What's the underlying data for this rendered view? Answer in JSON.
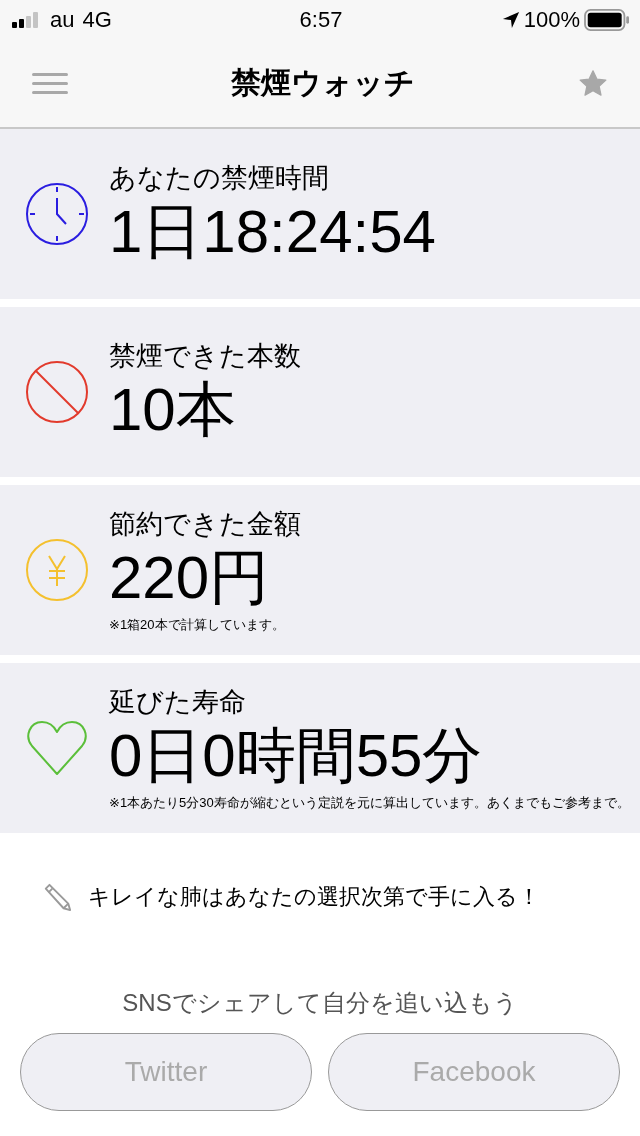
{
  "status_bar": {
    "carrier": "au",
    "network": "4G",
    "time": "6:57",
    "battery": "100%"
  },
  "nav_bar": {
    "title": "禁煙ウォッチ"
  },
  "stats": [
    {
      "kind": "clock",
      "label": "あなたの禁煙時間",
      "value": "1日18:24:54"
    },
    {
      "kind": "prohibited",
      "label": "禁煙できた本数",
      "value": "10本"
    },
    {
      "kind": "yen",
      "label": "節約できた金額",
      "value": "220円",
      "note": "※1箱20本で計算しています。"
    },
    {
      "kind": "heart",
      "label": "延びた寿命",
      "value": "0日0時間55分",
      "note": "※1本あたり5分30寿命が縮むという定説を元に算出しています。あくまでもご参考まで。"
    }
  ],
  "tip": "キレイな肺はあなたの選択次第で手に入る！",
  "share": {
    "prompt": "SNSでシェアして自分を追い込もう",
    "buttons": [
      "Twitter",
      "Facebook"
    ]
  }
}
